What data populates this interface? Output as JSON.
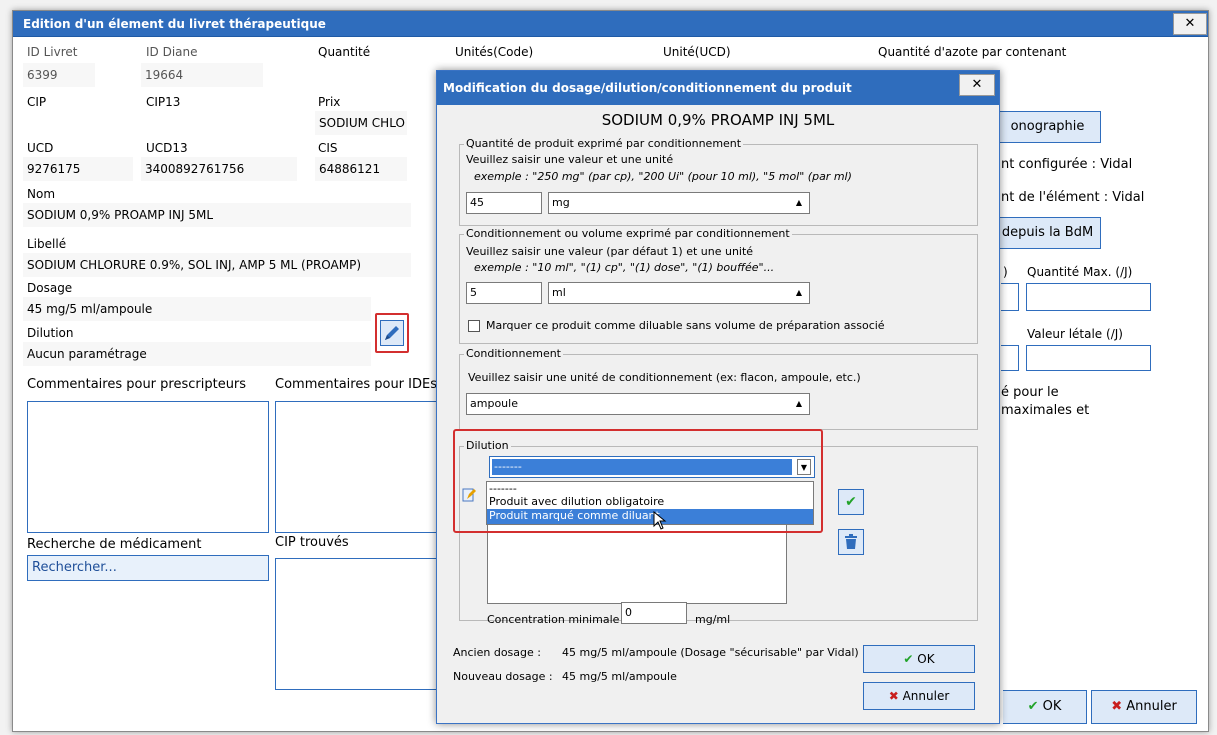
{
  "outer": {
    "title": "Edition d'un élement du livret thérapeutique",
    "close": "✕",
    "id_livret_label": "ID Livret",
    "id_livret": "6399",
    "id_diane_label": "ID Diane",
    "id_diane": "19664",
    "quantite_label": "Quantité",
    "unites_label": "Unités(Code)",
    "unite_ucd_label": "Unité(UCD)",
    "azote_label": "Quantité d'azote par contenant",
    "cip_label": "CIP",
    "cip13_label": "CIP13",
    "prix_label": "Prix",
    "prix_value": "SODIUM CHLO",
    "ucd_label": "UCD",
    "ucd": "9276175",
    "ucd13_label": "UCD13",
    "ucd13": "3400892761756",
    "cis_label": "CIS",
    "cis": "64886121",
    "nom_label": "Nom",
    "nom": "SODIUM 0,9% PROAMP INJ 5ML",
    "libelle_label": "Libellé",
    "libelle": "SODIUM CHLORURE 0.9%, SOL INJ, AMP 5 ML (PROAMP)",
    "dosage_label": "Dosage",
    "dosage": "45 mg/5 ml/ampoule",
    "dilution_label": "Dilution",
    "dilution": "Aucun paramétrage",
    "comm_presc_label": "Commentaires pour prescripteurs",
    "comm_ide_label": "Commentaires pour IDEs",
    "recherche_label": "Recherche de médicament",
    "recherche_placeholder": "Rechercher...",
    "cip_trouves_label": "CIP trouvés",
    "monographie": "onographie",
    "config_vidal": "nt configurée : Vidal",
    "element_vidal": "nt de l'élément : Vidal",
    "bdm": "depuis la BdM",
    "qmax_paren": ")",
    "qmax_label": "Quantité Max. (/J)",
    "letale_label": "Valeur létale (/J)",
    "note1": "é pour le",
    "note2": "maximales et",
    "ok": "OK",
    "annuler": "Annuler"
  },
  "dialog": {
    "title": "Modification du dosage/dilution/conditionnement du produit",
    "close": "✕",
    "product": "SODIUM 0,9% PROAMP INJ 5ML",
    "g1_title": "Quantité de produit exprimé par conditionnement",
    "g1_instr": "Veuillez saisir une valeur et une unité",
    "g1_example": "exemple : \"250 mg\" (par cp), \"200 Ui\" (pour 10 ml), \"5 mol\" (par ml)",
    "g1_value": "45",
    "g1_unit": "mg",
    "g2_title": "Conditionnement ou volume exprimé par conditionnement",
    "g2_instr": "Veuillez saisir une valeur (par défaut 1) et une unité",
    "g2_example": "exemple : \"10 ml\", \"(1) cp\", \"(1) dose\", \"(1) bouffée\"...",
    "g2_value": "5",
    "g2_unit": "ml",
    "g2_check": "Marquer ce produit comme diluable sans volume de préparation associé",
    "g3_title": "Conditionnement",
    "g3_instr": "Veuillez saisir une unité de conditionnement (ex: flacon, ampoule, etc.)",
    "g3_value": "ampoule",
    "g4_title": "Dilution",
    "g4_selected": "-------",
    "options": [
      "-------",
      "Produit avec dilution obligatoire",
      "Produit marqué comme diluant"
    ],
    "concentration_label": "Concentration minimale",
    "concentration_value": "0",
    "concentration_unit": "mg/ml",
    "ancien_label": "Ancien dosage :",
    "ancien_value": "45 mg/5 ml/ampoule (Dosage \"sécurisable\" par Vidal)",
    "nouveau_label": "Nouveau dosage :",
    "nouveau_value": "45 mg/5 ml/ampoule",
    "ok": "OK",
    "annuler": "Annuler"
  },
  "colors": {
    "title_bar": "#2f6dbd",
    "highlight": "#d32f2f",
    "selection": "#3b7fd8"
  }
}
